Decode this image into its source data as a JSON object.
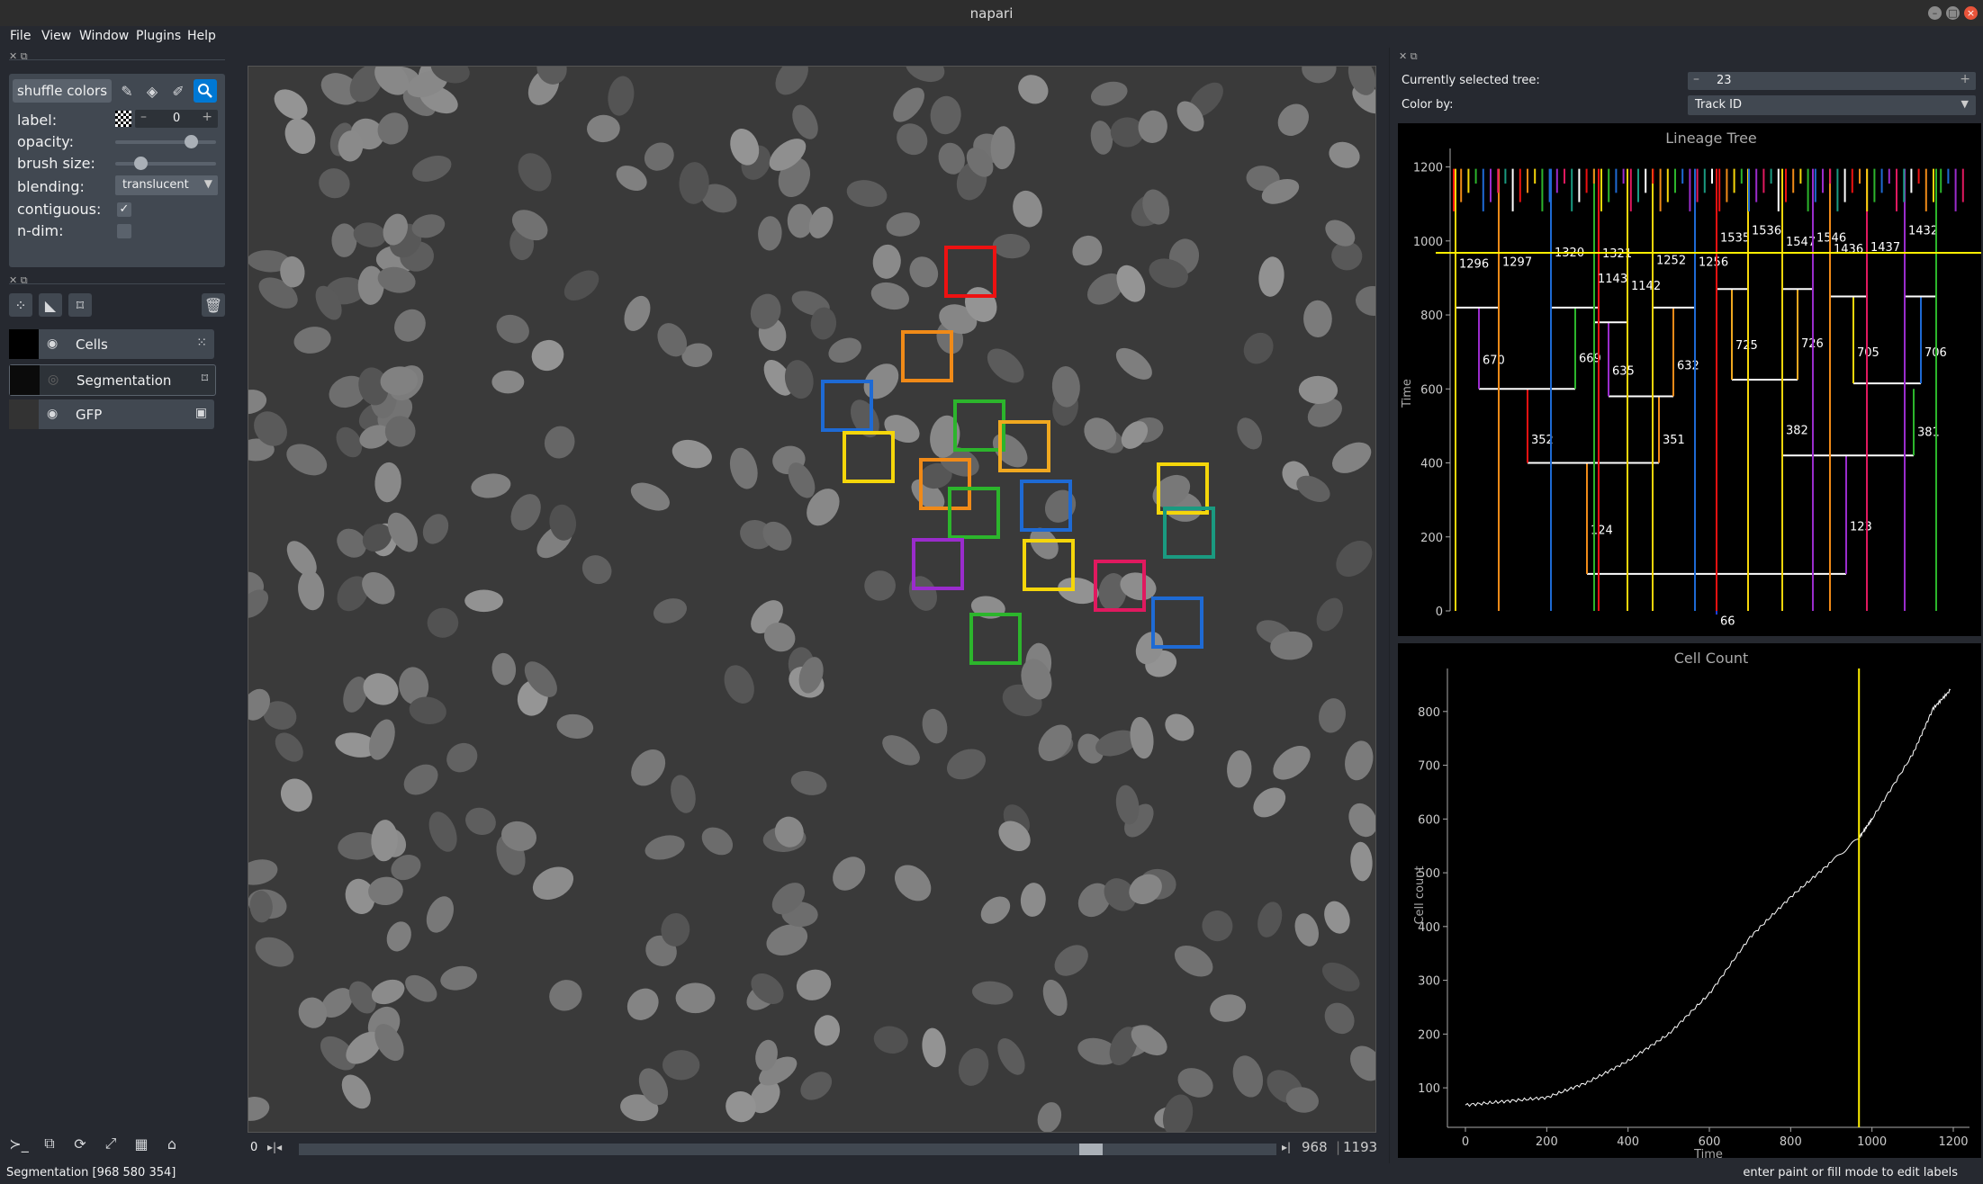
{
  "window": {
    "title": "napari"
  },
  "menu": [
    "File",
    "View",
    "Window",
    "Plugins",
    "Help"
  ],
  "layer_controls": {
    "shuffle_label": "shuffle colors",
    "label_label": "label:",
    "label_value": "0",
    "opacity_label": "opacity:",
    "opacity_value": 0.75,
    "brush_label": "brush size:",
    "brush_value": 0.25,
    "blending_label": "blending:",
    "blending_value": "translucent",
    "contiguous_label": "contiguous:",
    "ndim_label": "n-dim:"
  },
  "layers": [
    {
      "name": "Cells",
      "visible": true,
      "type_icon": "points-icon"
    },
    {
      "name": "Segmentation",
      "visible": false,
      "type_icon": "labels-icon"
    },
    {
      "name": "GFP",
      "visible": true,
      "type_icon": "image-icon"
    }
  ],
  "dims": {
    "start": "0",
    "current": "968",
    "max": "1193",
    "slider_fraction": 0.81
  },
  "right": {
    "tree_label": "Currently selected tree:",
    "tree_value": "23",
    "color_label": "Color by:",
    "color_value": "Track ID"
  },
  "colors": {
    "accent": "#0078d4",
    "background": "#262930",
    "widget": "#414851"
  },
  "charts": [
    {
      "type": "tree",
      "title": "Lineage Tree",
      "ylabel": "Time",
      "yticks": [
        0,
        200,
        400,
        600,
        800,
        1000,
        1200
      ],
      "current_time": 968,
      "node_labels": [
        "66",
        "124",
        "123",
        "352",
        "351",
        "382",
        "381",
        "670",
        "669",
        "635",
        "632",
        "725",
        "726",
        "705",
        "706",
        "1296",
        "1297",
        "1320",
        "1321",
        "1143",
        "1142",
        "1252",
        "1256",
        "1535",
        "1536",
        "1547",
        "1546",
        "1436",
        "1437",
        "1432"
      ]
    },
    {
      "type": "line",
      "title": "Cell Count",
      "xlabel": "Time",
      "ylabel": "Cell count",
      "xticks": [
        0,
        200,
        400,
        600,
        800,
        1000,
        1200
      ],
      "yticks": [
        100,
        200,
        300,
        400,
        500,
        600,
        700,
        800
      ],
      "current_time": 968,
      "x": [
        0,
        100,
        200,
        300,
        400,
        500,
        600,
        700,
        800,
        900,
        968,
        1000,
        1100,
        1150,
        1193
      ],
      "y": [
        68,
        75,
        82,
        110,
        150,
        200,
        275,
        380,
        455,
        520,
        565,
        600,
        720,
        805,
        840
      ]
    }
  ],
  "status": {
    "left": "Segmentation [968 580 354]",
    "right": "enter paint or fill mode to edit labels"
  }
}
